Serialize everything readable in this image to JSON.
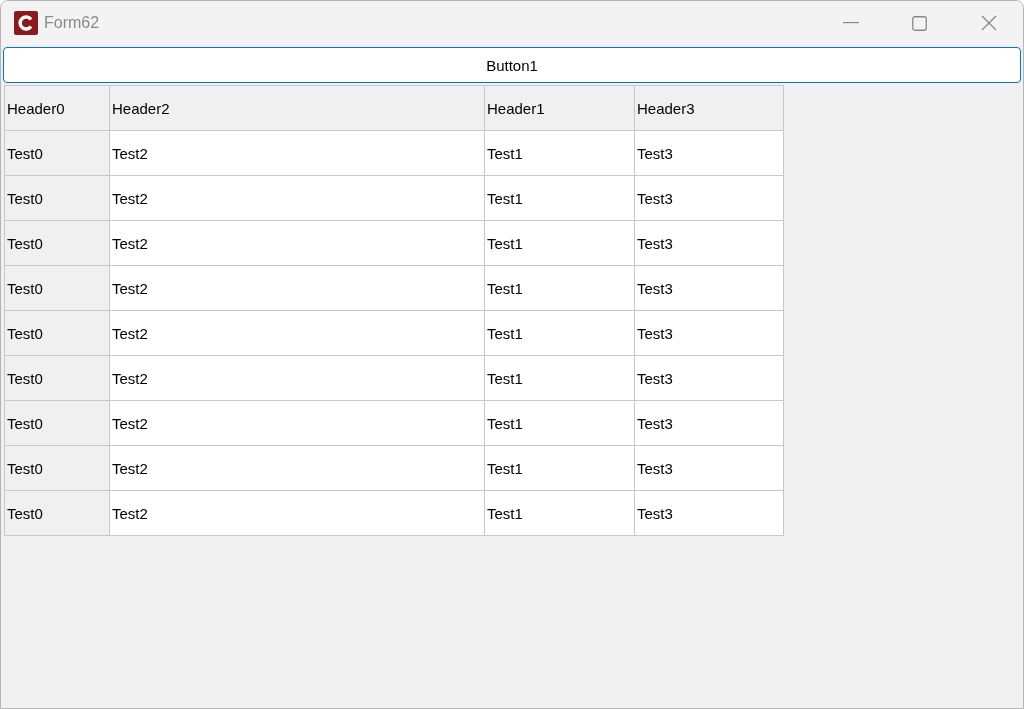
{
  "window": {
    "title": "Form62"
  },
  "button": {
    "label": "Button1"
  },
  "grid": {
    "columns": [
      {
        "label": "Header0",
        "fixed": true
      },
      {
        "label": "Header2",
        "fixed": false
      },
      {
        "label": "Header1",
        "fixed": false
      },
      {
        "label": "Header3",
        "fixed": false
      }
    ],
    "rows": [
      [
        "Test0",
        "Test2",
        "Test1",
        "Test3"
      ],
      [
        "Test0",
        "Test2",
        "Test1",
        "Test3"
      ],
      [
        "Test0",
        "Test2",
        "Test1",
        "Test3"
      ],
      [
        "Test0",
        "Test2",
        "Test1",
        "Test3"
      ],
      [
        "Test0",
        "Test2",
        "Test1",
        "Test3"
      ],
      [
        "Test0",
        "Test2",
        "Test1",
        "Test3"
      ],
      [
        "Test0",
        "Test2",
        "Test1",
        "Test3"
      ],
      [
        "Test0",
        "Test2",
        "Test1",
        "Test3"
      ],
      [
        "Test0",
        "Test2",
        "Test1",
        "Test3"
      ]
    ]
  }
}
